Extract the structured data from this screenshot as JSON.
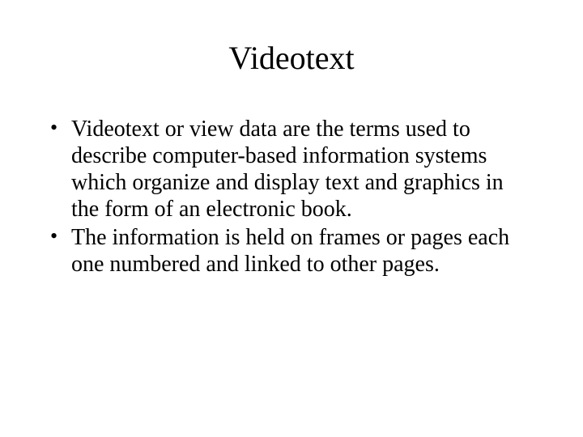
{
  "slide": {
    "title": "Videotext",
    "bullets": [
      "Videotext or view data are the terms used to describe computer-based information systems which organize and display text and graphics in the form of an electronic book.",
      "The information is held on frames or pages each one numbered and linked to other pages."
    ]
  }
}
